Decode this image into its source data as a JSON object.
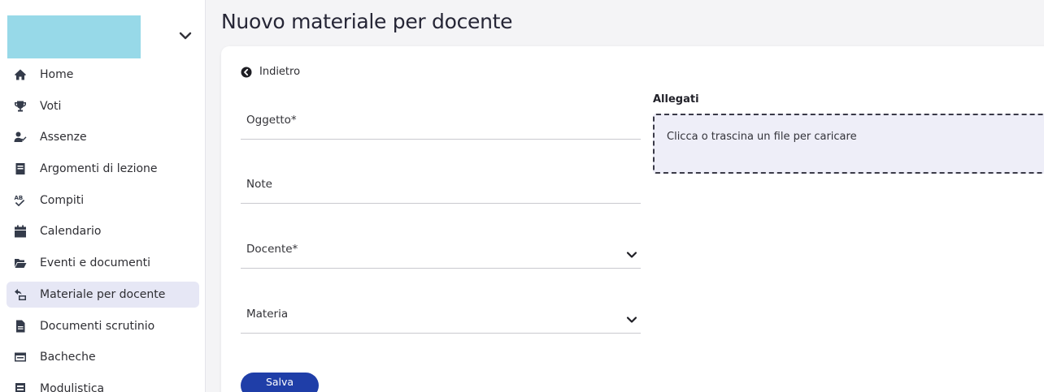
{
  "page": {
    "title": "Nuovo materiale per docente"
  },
  "sidebar": {
    "items": [
      {
        "label": "Home",
        "icon": "home-icon"
      },
      {
        "label": "Voti",
        "icon": "trophy-icon"
      },
      {
        "label": "Assenze",
        "icon": "user-check-icon"
      },
      {
        "label": "Argomenti di lezione",
        "icon": "book-icon"
      },
      {
        "label": "Compiti",
        "icon": "spell-check-icon"
      },
      {
        "label": "Calendario",
        "icon": "calendar-icon"
      },
      {
        "label": "Eventi e documenti",
        "icon": "folder-open-icon"
      },
      {
        "label": "Materiale per docente",
        "icon": "share-files-icon",
        "active": true
      },
      {
        "label": "Documenti scrutinio",
        "icon": "file-icon"
      },
      {
        "label": "Bacheche",
        "icon": "board-icon"
      },
      {
        "label": "Modulistica",
        "icon": "forms-icon"
      }
    ]
  },
  "form": {
    "back_label": "Indietro",
    "oggetto_label": "Oggetto*",
    "note_label": "Note",
    "docente_label": "Docente*",
    "materia_label": "Materia",
    "save_label": "Salva"
  },
  "attachments": {
    "title": "Allegati",
    "dropzone_text": "Clicca o trascina un file per caricare"
  },
  "colors": {
    "accent": "#1f3ea8",
    "active_nav_bg": "#e6e7f5",
    "logo_placeholder": "#97d9e8",
    "dropzone_bg": "#eeeef8"
  }
}
